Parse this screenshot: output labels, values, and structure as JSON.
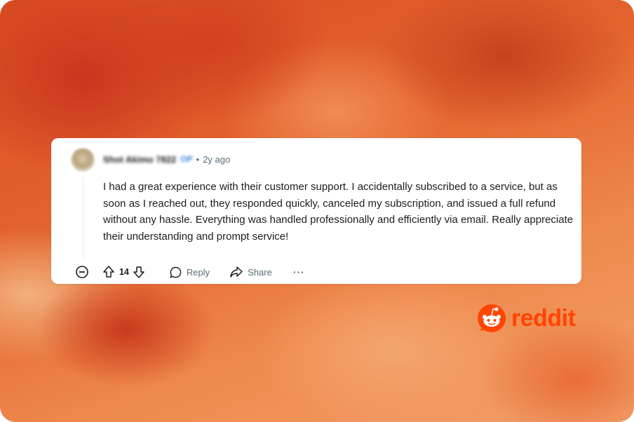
{
  "comment": {
    "username": "Shot Akimo 7822",
    "op_badge": "OP",
    "separator": "•",
    "timestamp": "2y ago",
    "body": "I had a great experience with their customer support. I accidentally subscribed to a service, but as soon as I reached out, they responded quickly, canceled my subscription, and issued a full refund without any hassle. Everything was handled professionally and efficiently via email. Really appreciate their understanding and prompt service!"
  },
  "actions": {
    "collapse_icon": "collapse-circle-icon",
    "upvote_icon": "upvote-arrow-icon",
    "vote_count": "14",
    "downvote_icon": "downvote-arrow-icon",
    "reply_label": "Reply",
    "share_label": "Share",
    "more_label": "···"
  },
  "brand": {
    "name": "reddit",
    "color": "#ff4500"
  }
}
